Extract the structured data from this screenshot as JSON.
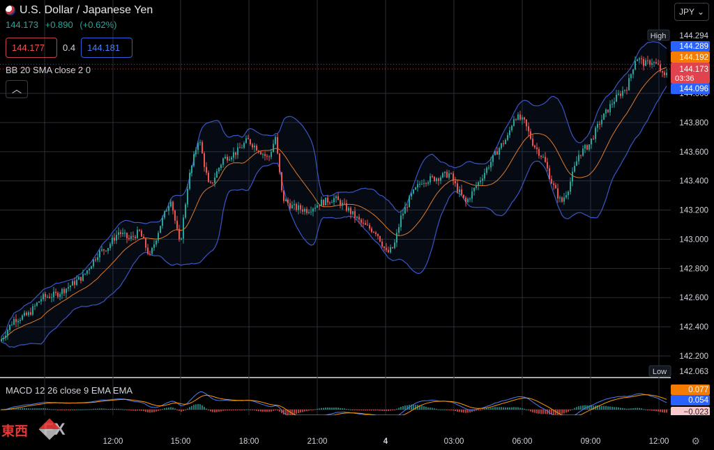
{
  "header": {
    "title": "U.S. Dollar / Japanese Yen",
    "last_price": "144.173",
    "change": "+0.890",
    "change_pct": "(+0.62%)"
  },
  "quote": {
    "sell": "144.177",
    "spread": "0.4",
    "buy": "144.181"
  },
  "indicators": {
    "bb": "BB 20 SMA close 2 0",
    "macd": "MACD 12 26 close 9 EMA EMA"
  },
  "currency_selector": {
    "value": "JPY",
    "caret": "⌄"
  },
  "watermark": {
    "cn": "東西",
    "fx": "FX"
  },
  "colors": {
    "up": "#26a69a",
    "down": "#ef5350",
    "bb_band": "#3a56c8",
    "bb_basis": "#e07a2a",
    "macd_line": "#4d7cf2",
    "signal_line": "#ff9800"
  },
  "chart_data": {
    "type": "candlestick",
    "price_axis": {
      "ticks": [
        "144.000",
        "143.800",
        "143.600",
        "143.400",
        "143.200",
        "143.000",
        "142.800",
        "142.600",
        "142.400",
        "142.200"
      ],
      "ylim": [
        142.0,
        144.35
      ]
    },
    "time_axis": {
      "ticks": [
        "12:00",
        "15:00",
        "18:00",
        "21:00",
        "4",
        "03:00",
        "06:00",
        "09:00",
        "12:00"
      ]
    },
    "labels": {
      "high": {
        "text": "High",
        "value": "144.294"
      },
      "low": {
        "text": "Low",
        "value": "142.063"
      },
      "bb_upper": "144.289",
      "bb_basis": "144.192",
      "last": "144.173",
      "countdown": "03:36",
      "bb_lower": "144.096"
    },
    "macd_labels": {
      "signal": "0.077",
      "macd": "0.054",
      "hist": "−0.023"
    },
    "path_points": [
      [
        0,
        142.3
      ],
      [
        20,
        142.45
      ],
      [
        40,
        142.48
      ],
      [
        60,
        142.6
      ],
      [
        80,
        142.62
      ],
      [
        100,
        142.68
      ],
      [
        120,
        142.75
      ],
      [
        140,
        142.9
      ],
      [
        155,
        142.95
      ],
      [
        170,
        143.05
      ],
      [
        185,
        143.0
      ],
      [
        200,
        143.05
      ],
      [
        215,
        142.88
      ],
      [
        230,
        143.1
      ],
      [
        245,
        143.28
      ],
      [
        258,
        142.95
      ],
      [
        270,
        143.4
      ],
      [
        285,
        143.7
      ],
      [
        300,
        143.35
      ],
      [
        320,
        143.55
      ],
      [
        340,
        143.6
      ],
      [
        355,
        143.68
      ],
      [
        370,
        143.62
      ],
      [
        385,
        143.55
      ],
      [
        395,
        143.7
      ],
      [
        405,
        143.28
      ],
      [
        420,
        143.22
      ],
      [
        440,
        143.2
      ],
      [
        460,
        143.25
      ],
      [
        480,
        143.28
      ],
      [
        500,
        143.2
      ],
      [
        520,
        143.1
      ],
      [
        540,
        143.05
      ],
      [
        555,
        142.9
      ],
      [
        565,
        142.95
      ],
      [
        575,
        143.15
      ],
      [
        590,
        143.3
      ],
      [
        605,
        143.4
      ],
      [
        625,
        143.42
      ],
      [
        645,
        143.45
      ],
      [
        655,
        143.35
      ],
      [
        668,
        143.25
      ],
      [
        685,
        143.38
      ],
      [
        700,
        143.5
      ],
      [
        715,
        143.62
      ],
      [
        728,
        143.7
      ],
      [
        738,
        143.85
      ],
      [
        752,
        143.8
      ],
      [
        765,
        143.65
      ],
      [
        780,
        143.55
      ],
      [
        792,
        143.38
      ],
      [
        805,
        143.25
      ],
      [
        815,
        143.35
      ],
      [
        830,
        143.58
      ],
      [
        845,
        143.65
      ],
      [
        860,
        143.8
      ],
      [
        880,
        143.95
      ],
      [
        900,
        144.05
      ],
      [
        912,
        144.25
      ],
      [
        925,
        144.2
      ],
      [
        935,
        144.22
      ],
      [
        945,
        144.18
      ],
      [
        952,
        144.1
      ],
      [
        958,
        144.17
      ]
    ]
  }
}
